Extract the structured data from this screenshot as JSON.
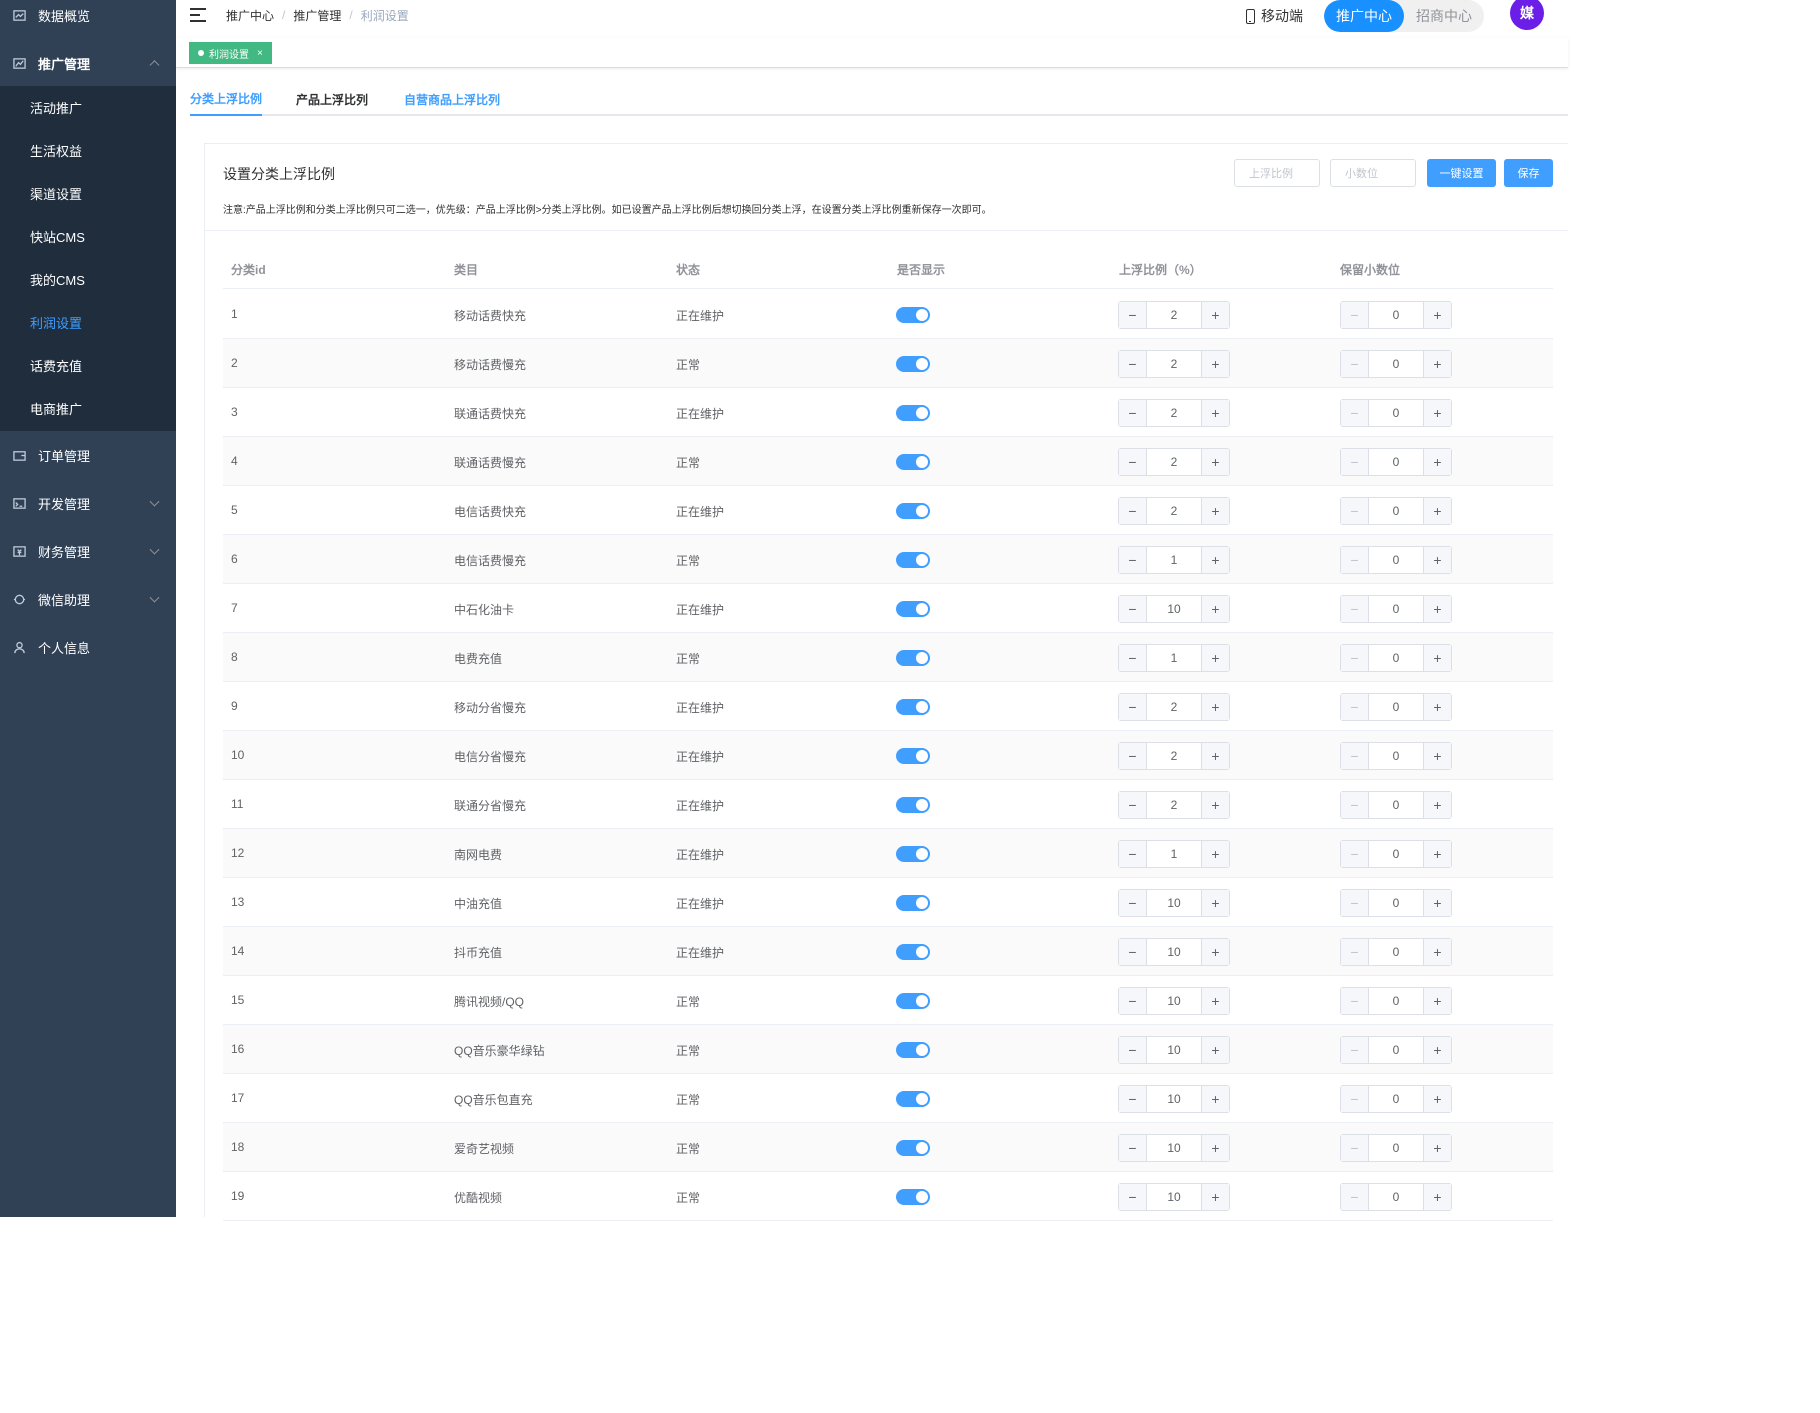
{
  "sidebar": {
    "items": [
      {
        "label": "数据概览",
        "icon": "dashboard-icon"
      },
      {
        "label": "推广管理",
        "icon": "chart-icon",
        "open": true,
        "children": [
          "活动推广",
          "生活权益",
          "渠道设置",
          "快站CMS",
          "我的CMS",
          "利润设置",
          "话费充值",
          "电商推广"
        ],
        "active_child": "利润设置"
      },
      {
        "label": "订单管理",
        "icon": "wallet-icon"
      },
      {
        "label": "开发管理",
        "icon": "terminal-icon",
        "has_children": true
      },
      {
        "label": "财务管理",
        "icon": "finance-icon",
        "has_children": true
      },
      {
        "label": "微信助理",
        "icon": "wechat-icon",
        "has_children": true
      },
      {
        "label": "个人信息",
        "icon": "user-icon"
      }
    ]
  },
  "header": {
    "breadcrumb": [
      "推广中心",
      "推广管理",
      "利润设置"
    ],
    "mobile_label": "移动端",
    "segments": [
      "推广中心",
      "招商中心"
    ],
    "active_segment": "推广中心",
    "avatar_text": "媒"
  },
  "tags": {
    "active": "利润设置",
    "close": "×"
  },
  "tabs": [
    "分类上浮比例",
    "产品上浮比列",
    "自营商品上浮比列"
  ],
  "card": {
    "title": "设置分类上浮比例",
    "note": "注意:产品上浮比例和分类上浮比例只可二选一，优先级：产品上浮比例>分类上浮比例。如已设置产品上浮比例后想切换回分类上浮，在设置分类上浮比例重新保存一次即可。",
    "ratio_placeholder": "上浮比例",
    "decimal_placeholder": "小数位",
    "one_click_label": "一键设置",
    "save_label": "保存"
  },
  "table": {
    "headers": [
      "分类id",
      "类目",
      "状态",
      "是否显示",
      "上浮比例（%）",
      "保留小数位"
    ],
    "rows": [
      {
        "id": "1",
        "name": "移动话费快充",
        "status": "正在维护",
        "ratio": "2",
        "decimals": "0"
      },
      {
        "id": "2",
        "name": "移动话费慢充",
        "status": "正常",
        "ratio": "2",
        "decimals": "0"
      },
      {
        "id": "3",
        "name": "联通话费快充",
        "status": "正在维护",
        "ratio": "2",
        "decimals": "0"
      },
      {
        "id": "4",
        "name": "联通话费慢充",
        "status": "正常",
        "ratio": "2",
        "decimals": "0"
      },
      {
        "id": "5",
        "name": "电信话费快充",
        "status": "正在维护",
        "ratio": "2",
        "decimals": "0"
      },
      {
        "id": "6",
        "name": "电信话费慢充",
        "status": "正常",
        "ratio": "1",
        "decimals": "0"
      },
      {
        "id": "7",
        "name": "中石化油卡",
        "status": "正在维护",
        "ratio": "10",
        "decimals": "0"
      },
      {
        "id": "8",
        "name": "电费充值",
        "status": "正常",
        "ratio": "1",
        "decimals": "0"
      },
      {
        "id": "9",
        "name": "移动分省慢充",
        "status": "正在维护",
        "ratio": "2",
        "decimals": "0"
      },
      {
        "id": "10",
        "name": "电信分省慢充",
        "status": "正在维护",
        "ratio": "2",
        "decimals": "0"
      },
      {
        "id": "11",
        "name": "联通分省慢充",
        "status": "正在维护",
        "ratio": "2",
        "decimals": "0"
      },
      {
        "id": "12",
        "name": "南网电费",
        "status": "正在维护",
        "ratio": "1",
        "decimals": "0"
      },
      {
        "id": "13",
        "name": "中油充值",
        "status": "正在维护",
        "ratio": "10",
        "decimals": "0"
      },
      {
        "id": "14",
        "name": "抖币充值",
        "status": "正在维护",
        "ratio": "10",
        "decimals": "0"
      },
      {
        "id": "15",
        "name": "腾讯视频/QQ",
        "status": "正常",
        "ratio": "10",
        "decimals": "0"
      },
      {
        "id": "16",
        "name": "QQ音乐豪华绿钻",
        "status": "正常",
        "ratio": "10",
        "decimals": "0"
      },
      {
        "id": "17",
        "name": "QQ音乐包直充",
        "status": "正常",
        "ratio": "10",
        "decimals": "0"
      },
      {
        "id": "18",
        "name": "爱奇艺视频",
        "status": "正常",
        "ratio": "10",
        "decimals": "0"
      },
      {
        "id": "19",
        "name": "优酷视频",
        "status": "正常",
        "ratio": "10",
        "decimals": "0"
      }
    ],
    "minus": "−",
    "plus": "+"
  },
  "colors": {
    "sidebar_bg": "#304156",
    "submenu_bg": "#1f2d3d",
    "accent": "#409eff",
    "tag_green": "#42b983",
    "avatar": "#6b1ee8"
  }
}
